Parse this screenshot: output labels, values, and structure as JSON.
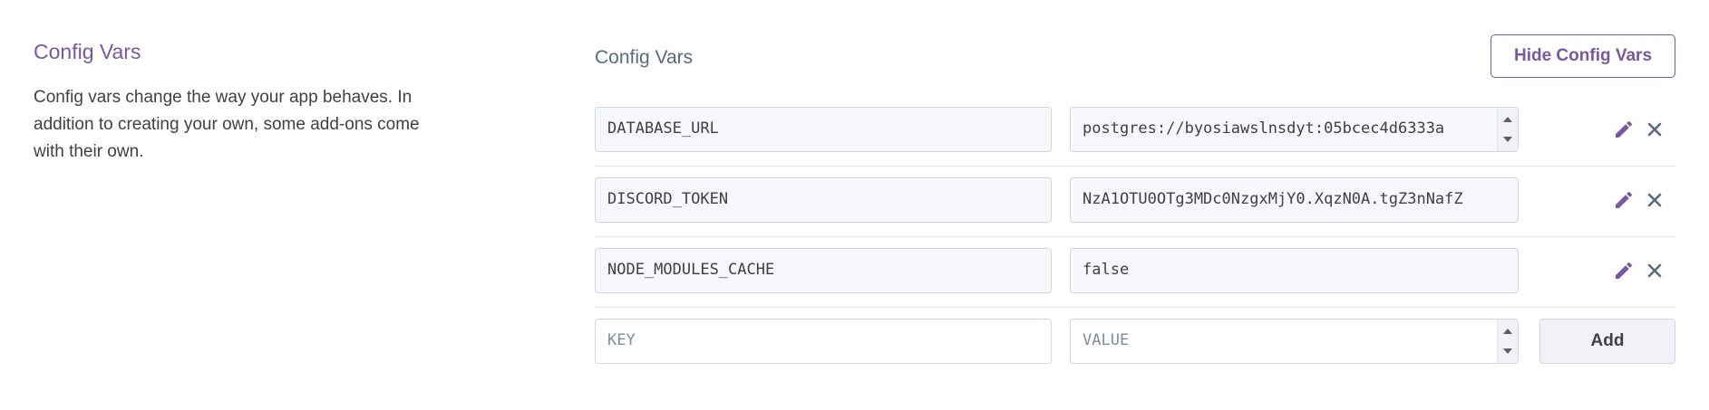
{
  "left": {
    "title": "Config Vars",
    "description": "Config vars change the way your app behaves. In addition to creating your own, some add-ons come with their own."
  },
  "right": {
    "title": "Config Vars",
    "hide_button_label": "Hide Config Vars"
  },
  "vars": [
    {
      "key": "DATABASE_URL",
      "value": "postgres://byosiawslnsdyt:05bcec4d6333a"
    },
    {
      "key": "DISCORD_TOKEN",
      "value": "NzA1OTU0OTg3MDc0NzgxMjY0.XqzN0A.tgZ3nNafZ"
    },
    {
      "key": "NODE_MODULES_CACHE",
      "value": "false"
    }
  ],
  "new_var": {
    "key_placeholder": "KEY",
    "value_placeholder": "VALUE",
    "add_label": "Add"
  },
  "colors": {
    "accent": "#79589f",
    "text": "#3f3f44",
    "muted": "#596981",
    "border": "#cfd7e6"
  },
  "icons": {
    "edit": "pencil-icon",
    "delete": "close-icon"
  }
}
